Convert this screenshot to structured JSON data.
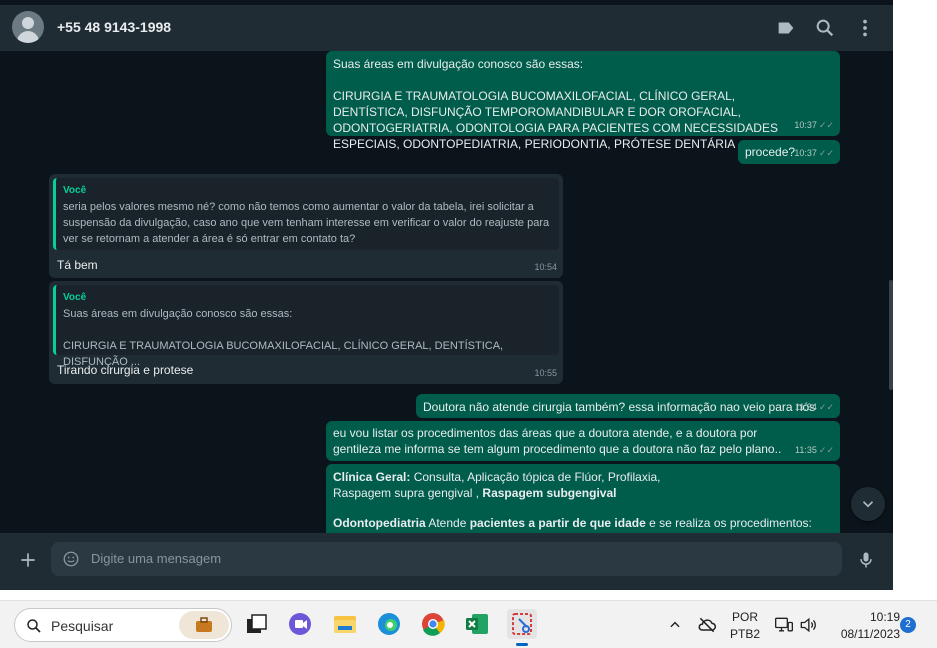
{
  "header": {
    "contact": "+55 48 9143-1998",
    "icons": [
      "label-icon",
      "search-icon",
      "menu-icon"
    ]
  },
  "messages": [
    {
      "id": "m1",
      "direction": "out",
      "line1": "Suas áreas em divulgação conosco são essas:",
      "line2": "CIRURGIA E TRAUMATOLOGIA BUCOMAXILOFACIAL, CLÍNICO GERAL, DENTÍSTICA, DISFUNÇÃO TEMPOROMANDIBULAR E DOR OROFACIAL, ODONTOGERIATRIA, ODONTOLOGIA PARA PACIENTES COM NECESSIDADES ESPECIAIS, ODONTOPEDIATRIA, PERIODONTIA, PRÓTESE DENTÁRIA",
      "time": "10:37"
    },
    {
      "id": "m2",
      "direction": "out",
      "text": "procede?",
      "time": "10:37"
    },
    {
      "id": "m3",
      "direction": "in",
      "quote_author": "Você",
      "quote_text": "seria pelos valores mesmo né? como não temos como aumentar o valor da tabela, irei solicitar a suspensão da divulgação, caso ano que vem tenham interesse em verificar o valor do reajuste para ver se retornam a atender a área é só entrar em contato ta?",
      "text": "Tá bem",
      "time": "10:54"
    },
    {
      "id": "m4",
      "direction": "in",
      "quote_author": "Você",
      "quote_line1": "Suas áreas em divulgação conosco são essas:",
      "quote_line2": "CIRURGIA E TRAUMATOLOGIA BUCOMAXILOFACIAL, CLÍNICO GERAL, DENTÍSTICA, DISFUNÇÃO ...",
      "text": "Tirando cirurgia e protese",
      "time": "10:55"
    },
    {
      "id": "m5",
      "direction": "out",
      "text": "Doutora não atende cirurgia também? essa informação nao veio para nós",
      "time": "11:34"
    },
    {
      "id": "m6",
      "direction": "out",
      "text": "eu vou listar os procedimentos das áreas que a doutora atende, e a doutora por gentileza me informa se tem algum procedimento que a doutora não faz pelo plano..",
      "time": "11:35"
    },
    {
      "id": "m7",
      "direction": "out",
      "clinico_label": "Clínica Geral:",
      "clinico_text1": " Consulta, Aplicação tópica de Flúor, Profilaxia,",
      "clinico_text2": "Raspagem supra gengival , ",
      "clinico_bold2": "Raspagem subgengival",
      "odonto_label": "Odontopediatria",
      "odonto_text1": " Atende ",
      "odonto_bold1": "pacientes a partir de que idade",
      "odonto_text2": " e se realiza os procedimentos:"
    }
  ],
  "composer": {
    "placeholder": "Digite uma mensagem"
  },
  "taskbar": {
    "search_placeholder": "Pesquisar",
    "lang_line1": "POR",
    "lang_line2": "PTB2",
    "clock_time": "10:19",
    "clock_date": "08/11/2023",
    "notification_count": "2"
  }
}
